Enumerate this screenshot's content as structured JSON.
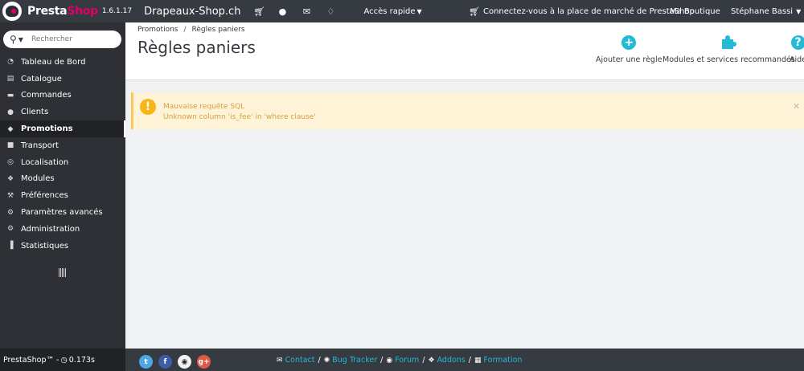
{
  "topbar": {
    "brand_a": "Presta",
    "brand_b": "Shop",
    "version": "1.6.1.17",
    "shop_name": "Drapeaux-Shop.ch",
    "icons": [
      "cart-icon",
      "user-icon",
      "envelope-icon",
      "trophy-icon"
    ],
    "quick_access": "Accès rapide",
    "marketplace": "Connectez-vous à la place de marché de PrestaShop",
    "my_shop": "Ma Boutique",
    "user_name": "Stéphane Bassi"
  },
  "search": {
    "placeholder": "Rechercher"
  },
  "sidebar": {
    "items": [
      {
        "label": "Tableau de Bord",
        "icon": "dashboard-icon"
      },
      {
        "label": "Catalogue",
        "icon": "book-icon"
      },
      {
        "label": "Commandes",
        "icon": "credit-card-icon"
      },
      {
        "label": "Clients",
        "icon": "users-icon"
      },
      {
        "label": "Promotions",
        "icon": "tags-icon"
      },
      {
        "label": "Transport",
        "icon": "truck-icon"
      },
      {
        "label": "Localisation",
        "icon": "globe-icon"
      },
      {
        "label": "Modules",
        "icon": "puzzle-icon"
      },
      {
        "label": "Préférences",
        "icon": "wrench-icon"
      },
      {
        "label": "Paramètres avancés",
        "icon": "cogs-icon"
      },
      {
        "label": "Administration",
        "icon": "gear-icon"
      },
      {
        "label": "Statistiques",
        "icon": "bar-chart-icon"
      }
    ],
    "active_index": 4
  },
  "header": {
    "breadcrumb_root": "Promotions",
    "breadcrumb_current": "Règles paniers",
    "title": "Règles paniers",
    "btn_add": "Ajouter une règle",
    "btn_modules": "Modules et services recommandés",
    "btn_help": "Aide"
  },
  "alert": {
    "line1": "Mauvaise requête SQL",
    "line2": "Unknown column 'is_fee' in 'where clause'"
  },
  "footer": {
    "version_text": "PrestaShop™ - ",
    "load_time": "0.173s",
    "socials": [
      "twitter-icon",
      "facebook-icon",
      "github-icon",
      "google-plus-icon"
    ],
    "links": [
      "Contact",
      "Bug Tracker",
      "Forum",
      "Addons",
      "Formation"
    ]
  },
  "colors": {
    "topbar": "#363a41",
    "sidebar": "#2e3036",
    "accent": "#25b9d7",
    "brand_pink": "#df0067",
    "warning": "#fcc85c",
    "warning_bg": "#fff3d7"
  }
}
